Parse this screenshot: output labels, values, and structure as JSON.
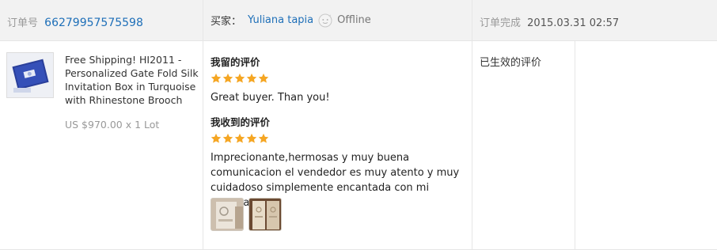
{
  "header": {
    "order_label": "订单号",
    "order_number": "66279957575598",
    "buyer_label": "买家：",
    "buyer_name": "Yuliana tapia",
    "buyer_status": "Offline",
    "completed_label": "订单完成",
    "completed_time": "2015.03.31 02:57"
  },
  "product": {
    "thumbnail_icon": "product-image",
    "title": "Free Shipping! HI2011 - Personalized Gate Fold Silk Invitation Box in Turquoise with Rhinestone Brooch",
    "price": "US $970.00 x 1 Lot"
  },
  "feedback_left": {
    "heading": "我留的评价",
    "stars": 5,
    "text": "Great buyer. Than you!"
  },
  "feedback_received": {
    "heading": "我收到的评价",
    "stars": 5,
    "text": "Imprecionante,hermosas y muy buena comunicacion el vendedor es muy atento y muy cuidadoso simplemente encantada con mi compra",
    "photos": [
      "photo-1",
      "photo-2"
    ]
  },
  "status": {
    "label": "已生效的评价"
  },
  "colors": {
    "link": "#1e6fb8",
    "star": "#f5a623",
    "header_bg": "#f2f2f2",
    "border": "#e6e6e6"
  }
}
